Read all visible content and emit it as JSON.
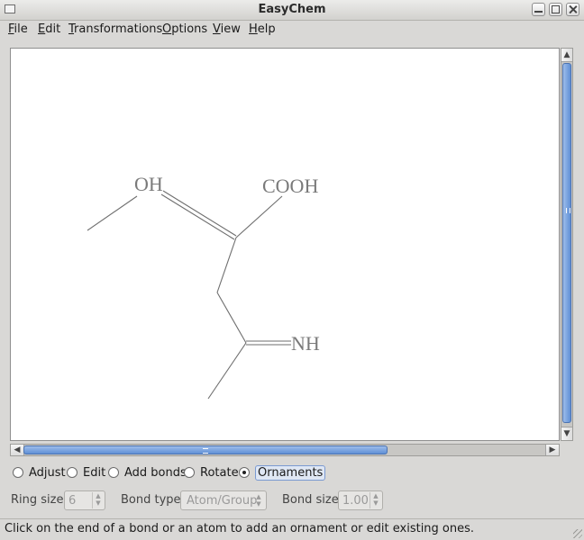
{
  "window": {
    "title": "EasyChem"
  },
  "menu": {
    "items": [
      {
        "label": "File",
        "mnemonic": "F",
        "rest": "ile"
      },
      {
        "label": "Edit",
        "mnemonic": "E",
        "rest": "dit"
      },
      {
        "label": "Transformations",
        "mnemonic": "T",
        "rest": "ransformations"
      },
      {
        "label": "Options",
        "mnemonic": "O",
        "rest": "ptions"
      },
      {
        "label": "View",
        "mnemonic": "V",
        "rest": "iew"
      },
      {
        "label": "Help",
        "mnemonic": "H",
        "rest": "elp"
      }
    ]
  },
  "molecule": {
    "labels": {
      "oh": "OH",
      "cooh": "COOH",
      "nh": "NH"
    },
    "colors": {
      "bond": "#6e6e6e",
      "label": "#7a7a7a"
    }
  },
  "modes": {
    "options": [
      "Adjust",
      "Edit",
      "Add bonds",
      "Rotate",
      "Ornaments"
    ],
    "selected": "Ornaments"
  },
  "params": {
    "ring_size_label": "Ring size:",
    "ring_size_value": "6",
    "bond_type_label": "Bond type:",
    "bond_type_value": "Atom/Group",
    "bond_size_label": "Bond size:",
    "bond_size_value": "1.00"
  },
  "status": {
    "text": "Click on the end of a bond or an atom to add an ornament or edit existing ones."
  },
  "theme": {
    "scroll_thumb": "#5f8fd6",
    "window_bg": "#d9d8d6"
  }
}
